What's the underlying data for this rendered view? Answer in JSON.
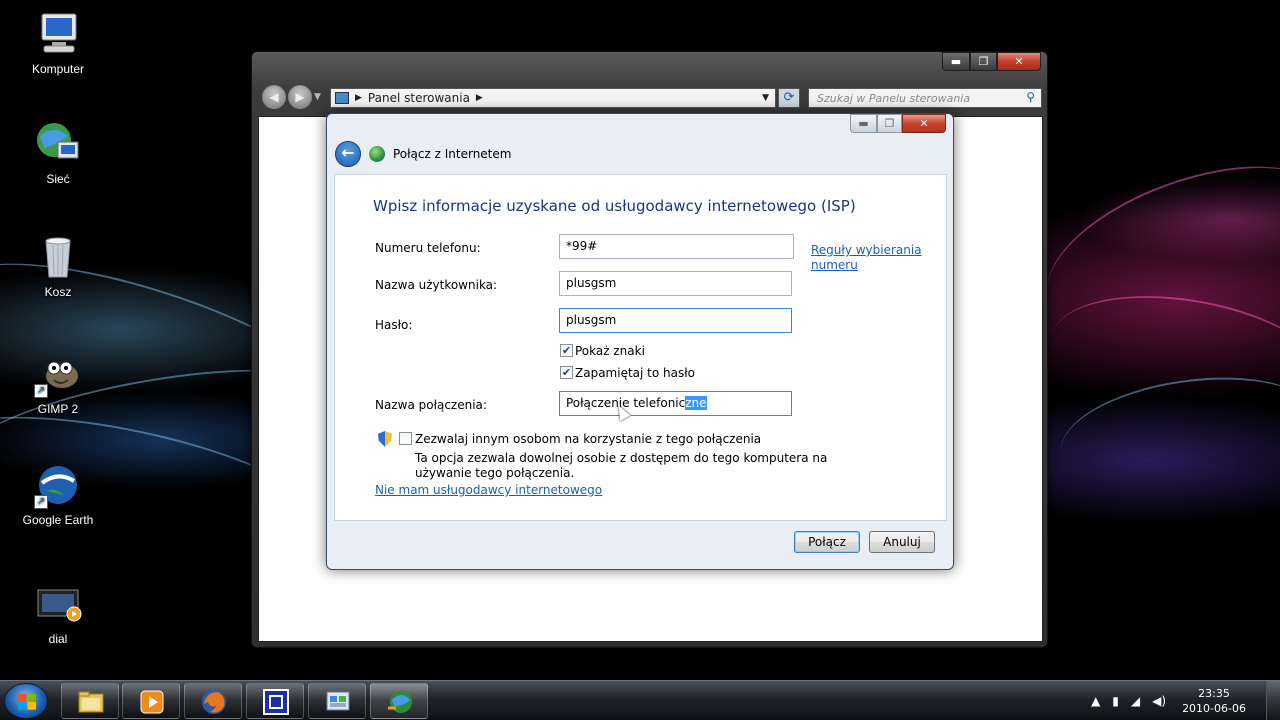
{
  "desktop": {
    "icons": [
      {
        "label": "Komputer"
      },
      {
        "label": "Sieć"
      },
      {
        "label": "Kosz"
      },
      {
        "label": "GIMP 2"
      },
      {
        "label": "Google Earth"
      },
      {
        "label": "dial"
      }
    ]
  },
  "explorer": {
    "breadcrumb": "Panel sterowania",
    "search_placeholder": "Szukaj w Panelu sterowania"
  },
  "dialog": {
    "title": "Połącz z Internetem",
    "heading": "Wpisz informacje uzyskane od usługodawcy internetowego (ISP)",
    "phone_label": "Numeru telefonu:",
    "phone_value": "*99#",
    "dialing_rules_link": "Reguły wybierania numeru",
    "username_label": "Nazwa użytkownika:",
    "username_value": "plusgsm",
    "password_label": "Hasło:",
    "password_value": "plusgsm",
    "show_chars_label": "Pokaż znaki",
    "show_chars_checked": true,
    "remember_password_label": "Zapamiętaj to hasło",
    "remember_password_checked": true,
    "connection_name_label": "Nazwa połączenia:",
    "connection_name_value_unselected": "Połączenie telefonic",
    "connection_name_value_selected": "zne",
    "allow_others_label": "Zezwalaj innym osobom na korzystanie z tego połączenia",
    "allow_others_checked": false,
    "allow_others_note": "Ta opcja zezwala dowolnej osobie z dostępem do tego komputera na używanie tego połączenia.",
    "no_isp_link": "Nie mam usługodawcy internetowego",
    "connect_button": "Połącz",
    "cancel_button": "Anuluj"
  },
  "taskbar": {
    "time": "23:35",
    "date": "2010-06-06"
  }
}
